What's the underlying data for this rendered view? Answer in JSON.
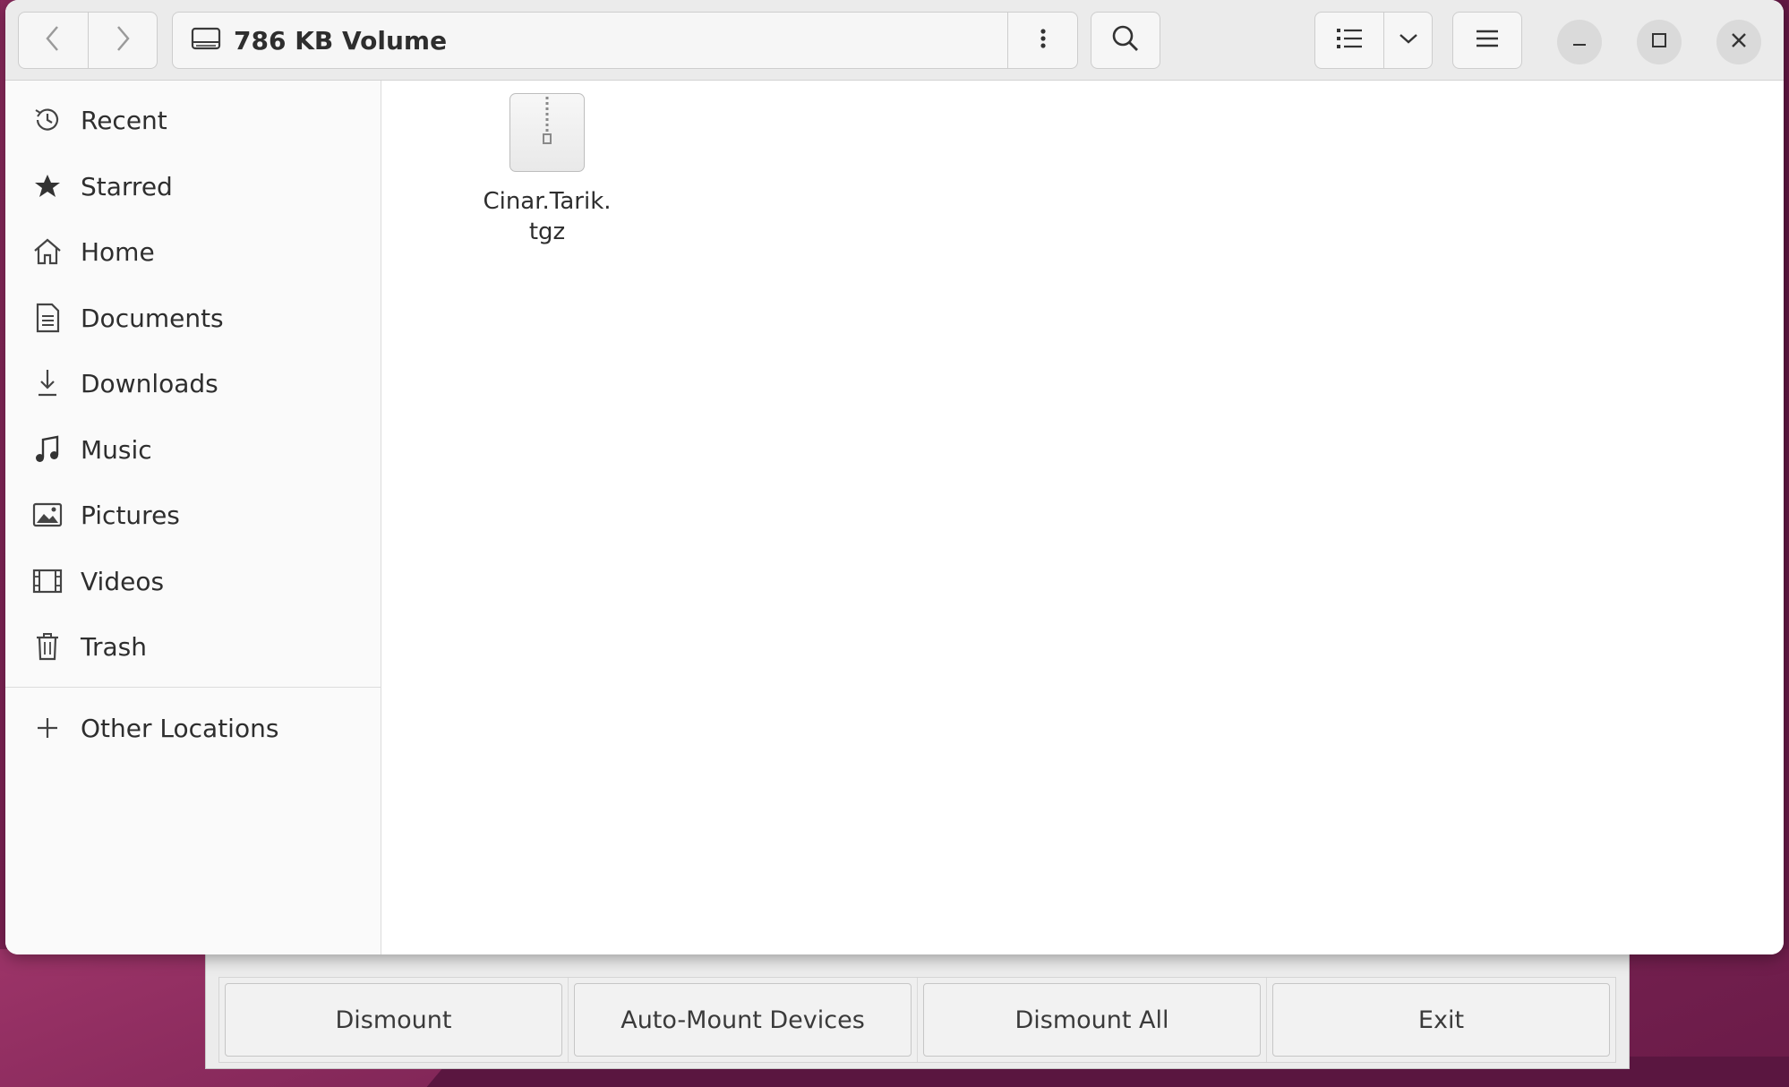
{
  "window": {
    "location_title": "786 KB Volume"
  },
  "toolbar": {
    "back_icon": "chevron-left-icon",
    "forward_icon": "chevron-right-icon",
    "location_icon": "drive-icon",
    "path_menu_icon": "vertical-dots-icon",
    "search_icon": "search-icon",
    "list_view_icon": "list-view-icon",
    "view_options_icon": "chevron-down-icon",
    "main_menu_icon": "hamburger-menu-icon",
    "minimize_icon": "minimize-icon",
    "maximize_icon": "maximize-icon",
    "close_icon": "close-icon"
  },
  "sidebar": {
    "items": [
      {
        "label": "Recent",
        "icon": "recent-clock-icon"
      },
      {
        "label": "Starred",
        "icon": "star-icon"
      },
      {
        "label": "Home",
        "icon": "home-icon"
      },
      {
        "label": "Documents",
        "icon": "document-icon"
      },
      {
        "label": "Downloads",
        "icon": "download-icon"
      },
      {
        "label": "Music",
        "icon": "music-note-icon"
      },
      {
        "label": "Pictures",
        "icon": "picture-icon"
      },
      {
        "label": "Videos",
        "icon": "film-icon"
      },
      {
        "label": "Trash",
        "icon": "trash-icon"
      }
    ],
    "other_locations": {
      "label": "Other Locations",
      "icon": "plus-icon"
    }
  },
  "files": [
    {
      "name": "Cinar.Tarik.tgz",
      "name_line1": "Cinar.Tarik.",
      "name_line2": "tgz",
      "icon": "archive-icon"
    }
  ],
  "background_app": {
    "buttons": [
      "Dismount",
      "Auto-Mount Devices",
      "Dismount All",
      "Exit"
    ]
  },
  "colors": {
    "accent_desktop": "#7a1f52",
    "window_bg": "#ffffff",
    "headerbar_bg": "#ebebeb",
    "sidebar_bg": "#fafafa"
  }
}
